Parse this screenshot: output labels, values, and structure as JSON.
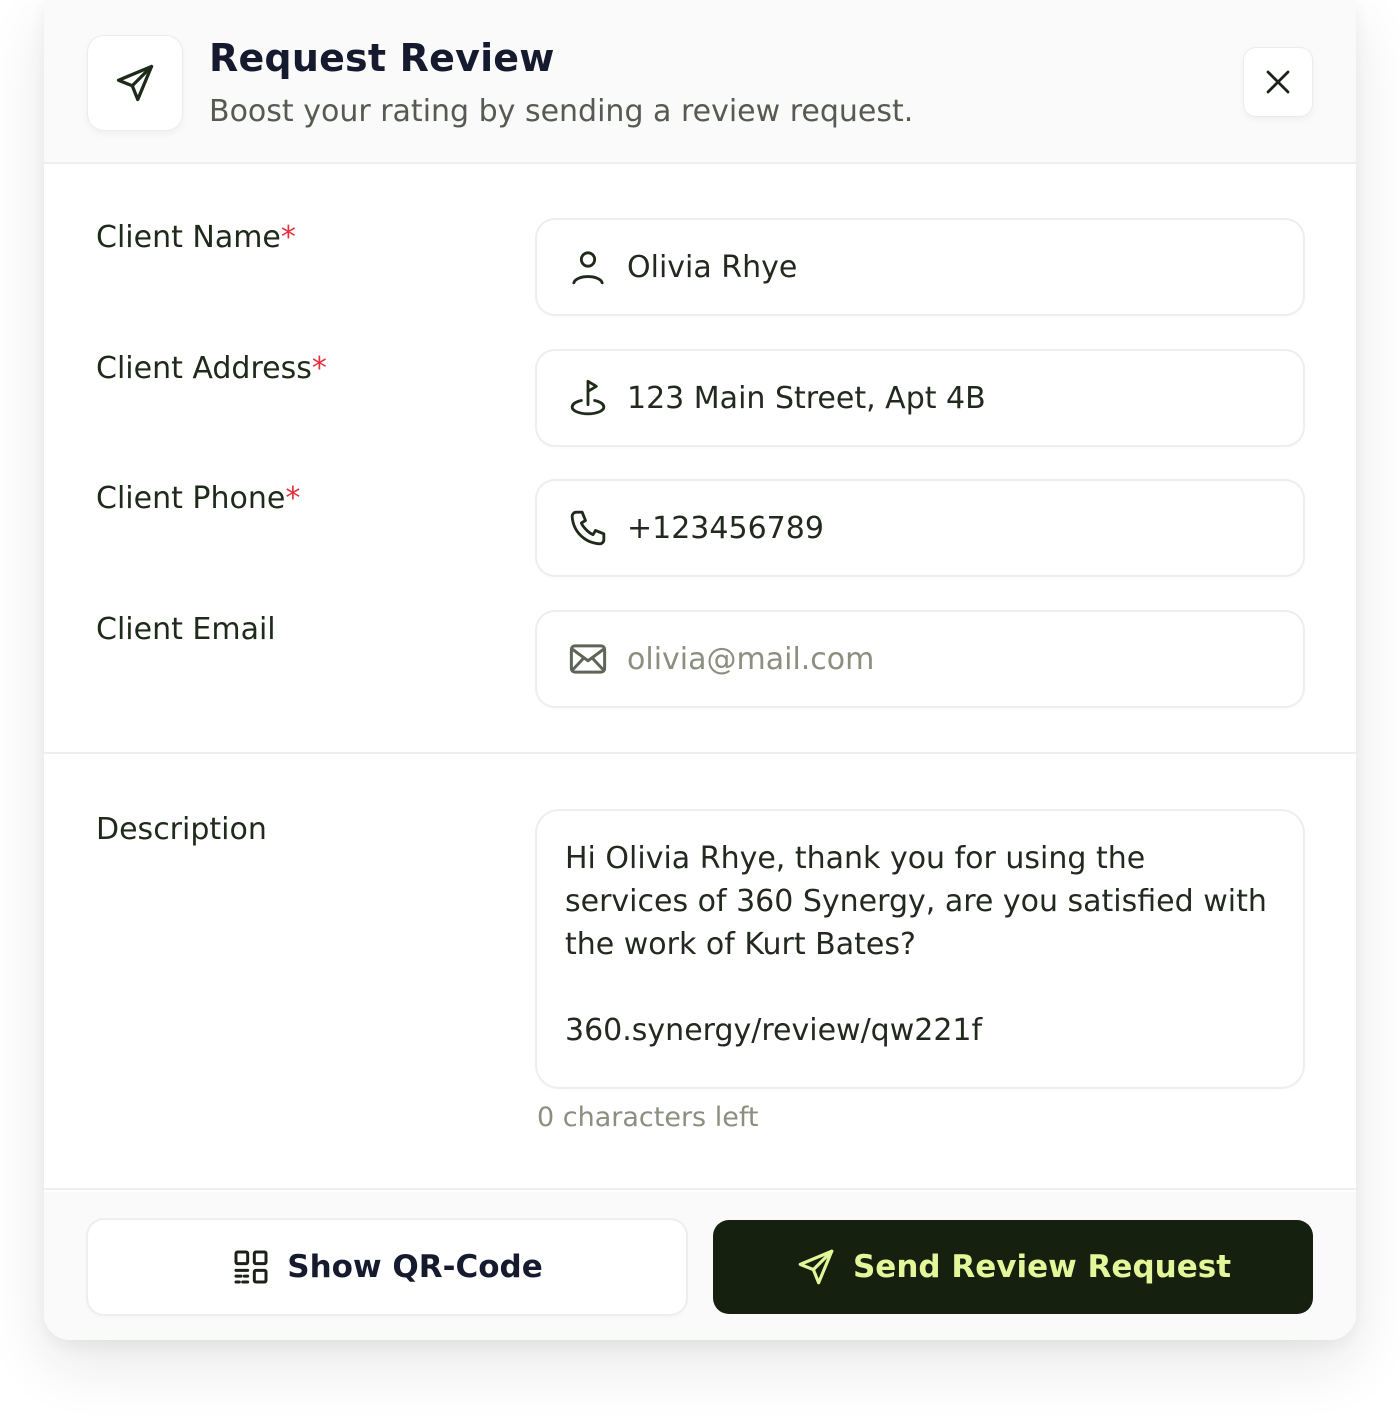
{
  "header": {
    "title": "Request Review",
    "subtitle": "Boost your rating by sending a review request.",
    "icon": "send-icon",
    "close_icon": "close-icon"
  },
  "form": {
    "fields": [
      {
        "label": "Client Name",
        "required": "*",
        "value": "Olivia Rhye",
        "icon": "user-icon"
      },
      {
        "label": "Client Address",
        "required": "*",
        "value": "123 Main Street, Apt 4B",
        "icon": "location-icon"
      },
      {
        "label": "Client Phone",
        "required": "*",
        "value": "+123456789",
        "icon": "phone-icon"
      },
      {
        "label": "Client Email",
        "placeholder": "olivia@mail.com",
        "icon": "mail-icon"
      }
    ]
  },
  "description": {
    "label": "Description",
    "text": "Hi Olivia Rhye, thank you for using the services of 360 Synergy, are you satisfied with the work of Kurt Bates?\n\n360.synergy/review/qw221f",
    "counter": "0 characters left"
  },
  "footer": {
    "qr_label": "Show QR-Code",
    "qr_icon": "qr-code-icon",
    "send_label": "Send Review Request",
    "send_icon": "send-icon"
  },
  "colors": {
    "primary_button_bg": "#15200f",
    "primary_button_text": "#e3f79a",
    "required_marker": "#e5303b",
    "title": "#161a2e"
  }
}
